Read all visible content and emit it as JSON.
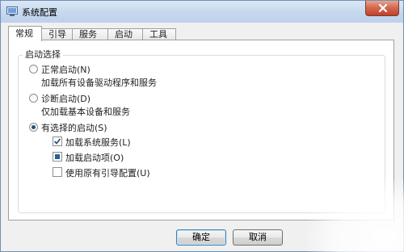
{
  "window": {
    "title": "系统配置"
  },
  "tabs": [
    {
      "label": "常规",
      "active": true
    },
    {
      "label": "引导",
      "active": false
    },
    {
      "label": "服务",
      "active": false
    },
    {
      "label": "启动",
      "active": false
    },
    {
      "label": "工具",
      "active": false
    }
  ],
  "startup": {
    "group_label": "启动选择",
    "normal": {
      "label": "正常启动(N)",
      "description": "加载所有设备驱动程序和服务",
      "selected": false
    },
    "diagnostic": {
      "label": "诊断启动(D)",
      "description": "仅加载基本设备和服务",
      "selected": false
    },
    "selective": {
      "label": "有选择的启动(S)",
      "selected": true,
      "options": [
        {
          "label": "加载系统服务(L)",
          "state": "checked"
        },
        {
          "label": "加载启动项(O)",
          "state": "indeterminate"
        },
        {
          "label": "使用原有引导配置(U)",
          "state": "unchecked"
        }
      ]
    }
  },
  "buttons": {
    "ok": "确定",
    "cancel": "取消"
  },
  "colors": {
    "accent": "#1c5180",
    "titlebar": "#c6d8ee",
    "close": "#c2402a"
  }
}
